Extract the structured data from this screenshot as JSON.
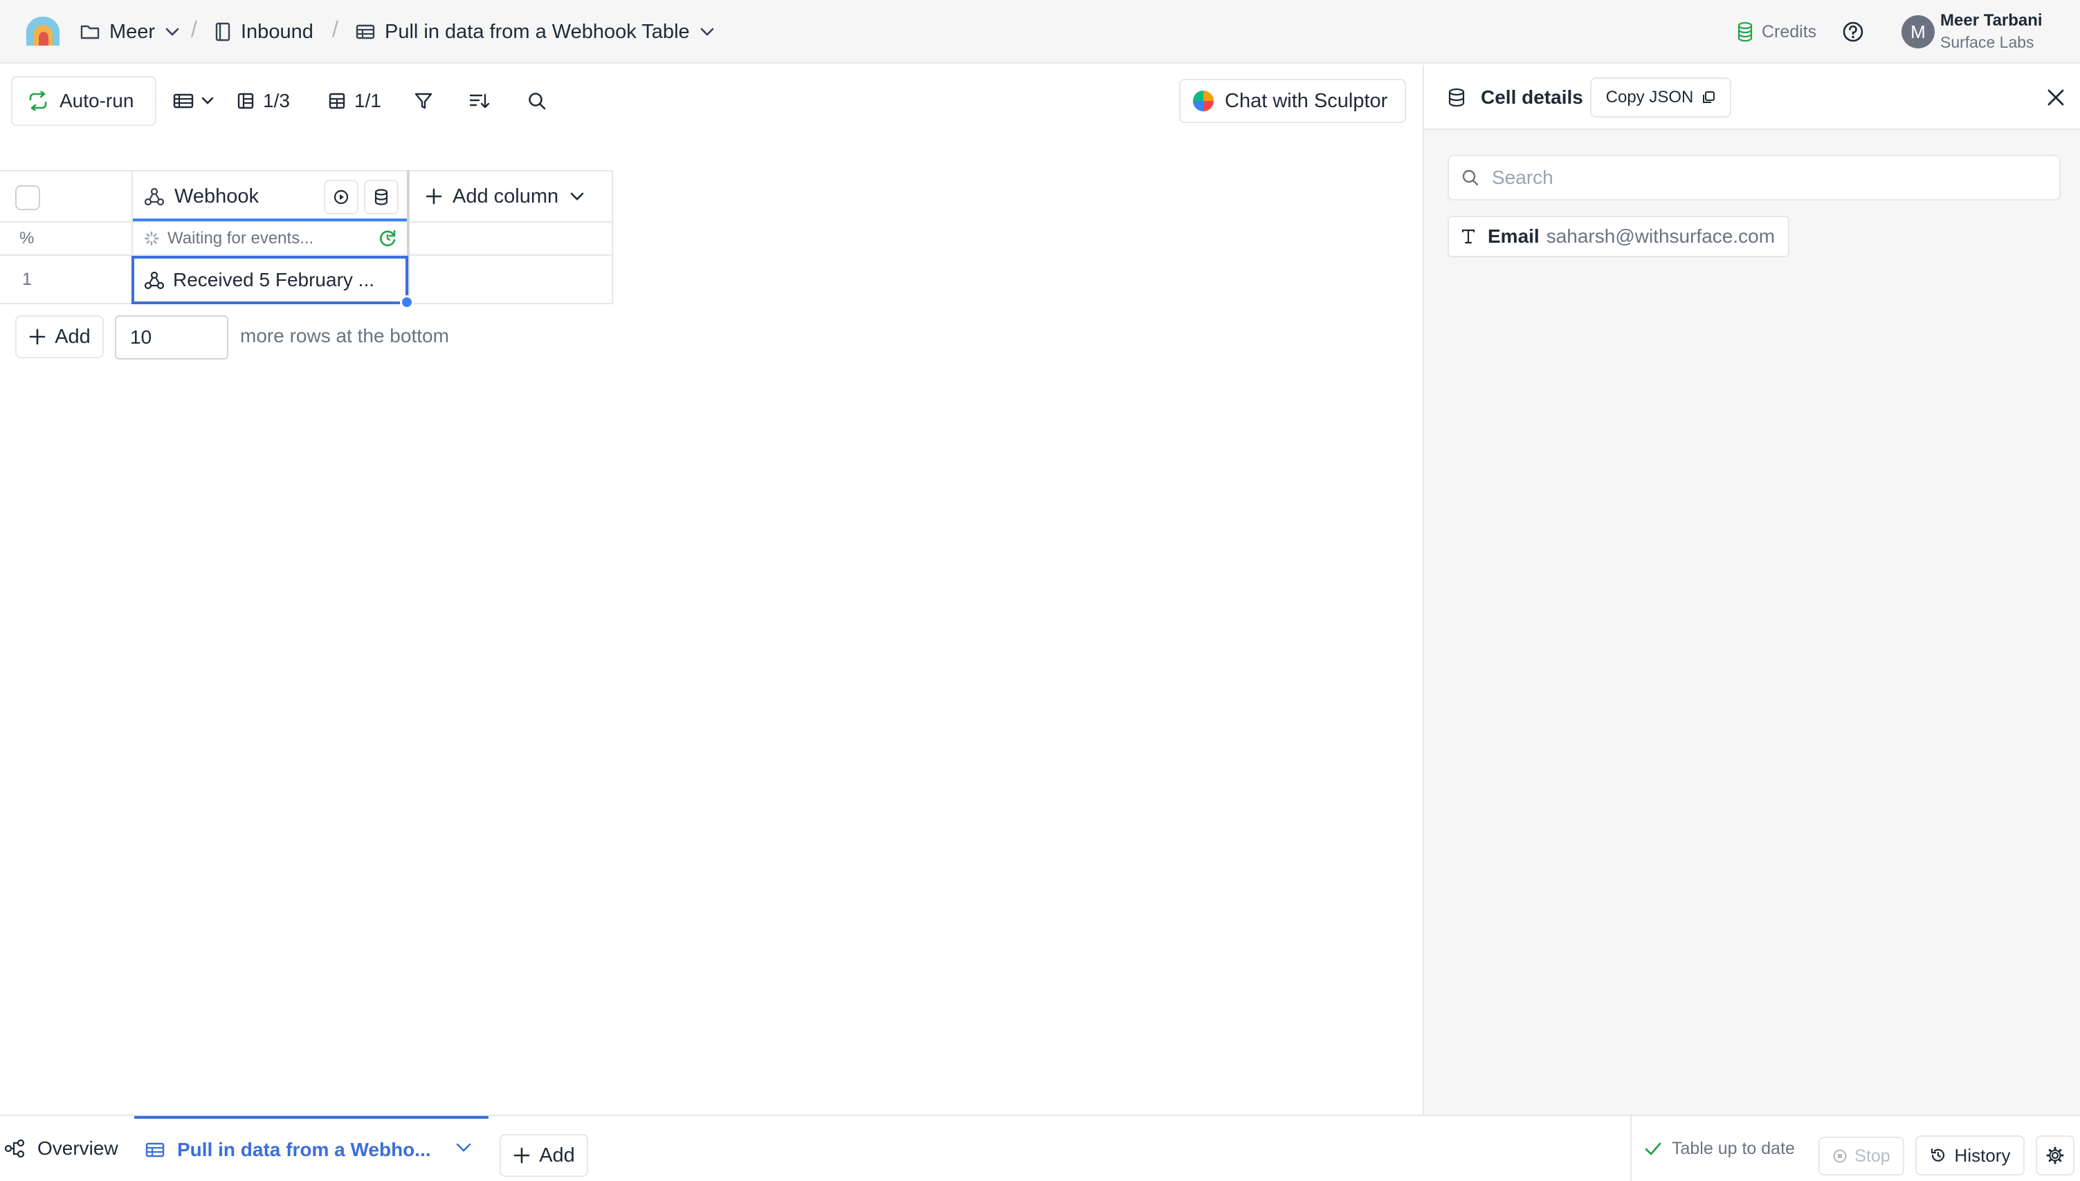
{
  "breadcrumb": {
    "workspace": "Meer",
    "folder": "Inbound",
    "table": "Pull in data from a Webhook Table"
  },
  "header": {
    "credits_label": "Credits",
    "user_name": "Meer Tarbani",
    "user_org": "Surface Labs",
    "avatar_initial": "M"
  },
  "toolbar": {
    "autorun_label": "Auto-run",
    "columns_count": "1/3",
    "rows_count": "1/1",
    "chat_label": "Chat with Sculptor"
  },
  "grid": {
    "column_header": "Webhook",
    "add_column_label": "Add column",
    "status_row_marker": "%",
    "status_text": "Waiting for events...",
    "rows": [
      {
        "index": "1",
        "webhook": "Received 5 February ..."
      }
    ]
  },
  "add_rows": {
    "button_label": "Add",
    "count_value": "10",
    "suffix_text": "more rows at the bottom"
  },
  "panel": {
    "title": "Cell details",
    "copy_json_label": "Copy JSON",
    "search_placeholder": "Search",
    "fields": [
      {
        "key": "Email",
        "value": "saharsh@withsurface.com"
      }
    ]
  },
  "bottom": {
    "overview_label": "Overview",
    "active_tab_label": "Pull in data from a Webho...",
    "add_label": "Add",
    "status_label": "Table up to date",
    "stop_label": "Stop",
    "history_label": "History"
  },
  "colors": {
    "accent": "#3b6fd8",
    "success": "#22a34a"
  }
}
